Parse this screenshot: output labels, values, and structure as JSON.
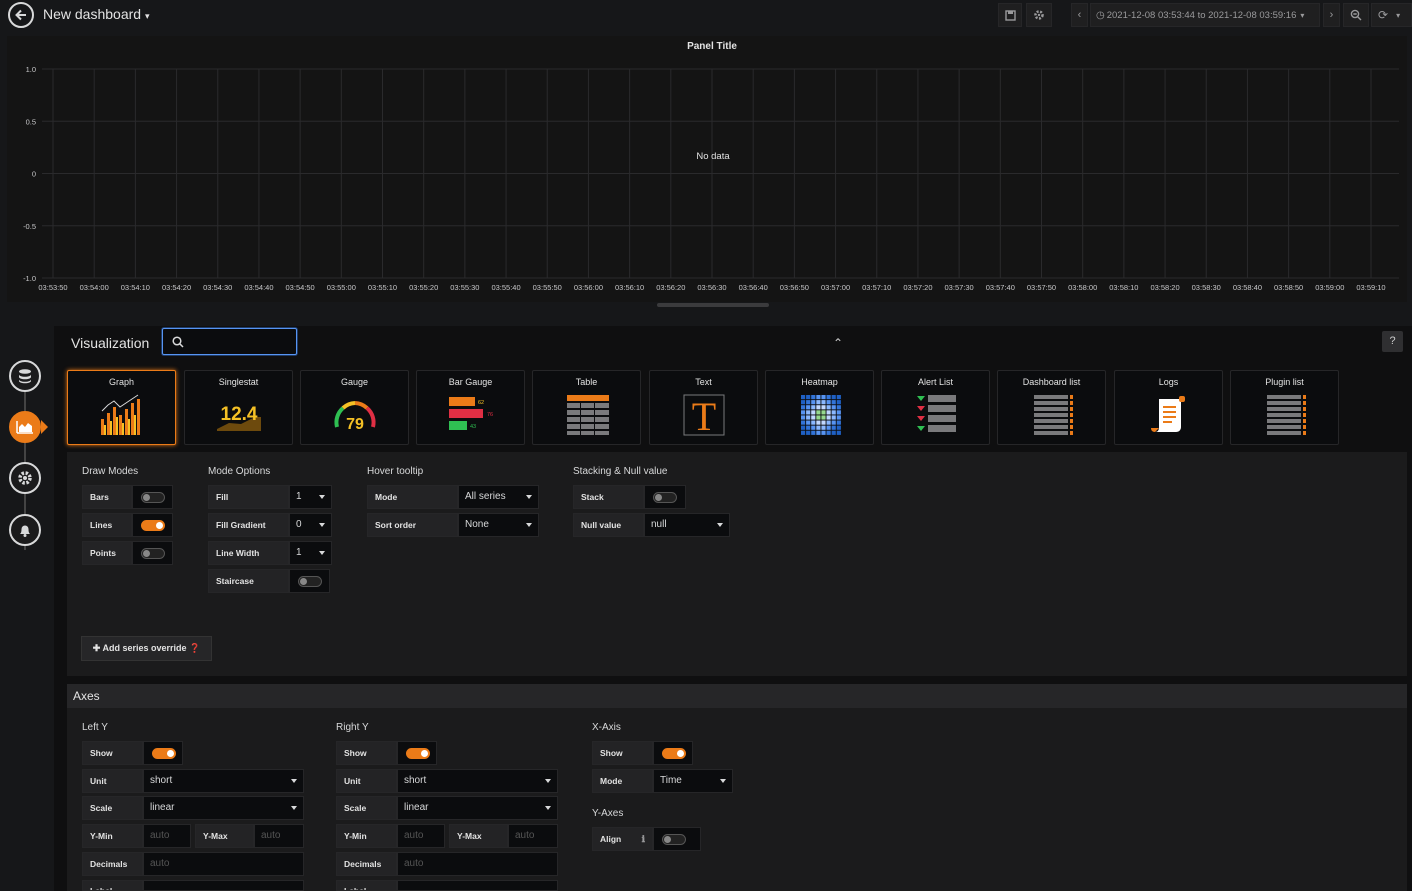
{
  "header": {
    "title": "New dashboard",
    "time_range": "2021-12-08 03:53:44 to 2021-12-08 03:59:16"
  },
  "panel": {
    "title": "Panel Title",
    "no_data": "No data",
    "y_ticks": [
      "1.0",
      "0.5",
      "0",
      "-0.5",
      "-1.0"
    ],
    "x_ticks": [
      "03:53:50",
      "03:54:00",
      "03:54:10",
      "03:54:20",
      "03:54:30",
      "03:54:40",
      "03:54:50",
      "03:55:00",
      "03:55:10",
      "03:55:20",
      "03:55:30",
      "03:55:40",
      "03:55:50",
      "03:56:00",
      "03:56:10",
      "03:56:20",
      "03:56:30",
      "03:56:40",
      "03:56:50",
      "03:57:00",
      "03:57:10",
      "03:57:20",
      "03:57:30",
      "03:57:40",
      "03:57:50",
      "03:58:00",
      "03:58:10",
      "03:58:20",
      "03:58:30",
      "03:58:40",
      "03:58:50",
      "03:59:00",
      "03:59:10"
    ]
  },
  "visualization": {
    "label": "Visualization",
    "help": "?",
    "types": [
      {
        "label": "Graph",
        "icon": "graph-icon"
      },
      {
        "label": "Singlestat",
        "icon": "singlestat-icon",
        "value": "12.4"
      },
      {
        "label": "Gauge",
        "icon": "gauge-icon",
        "value": "79"
      },
      {
        "label": "Bar Gauge",
        "icon": "bar-gauge-icon"
      },
      {
        "label": "Table",
        "icon": "table-icon"
      },
      {
        "label": "Text",
        "icon": "text-icon",
        "glyph": "T"
      },
      {
        "label": "Heatmap",
        "icon": "heatmap-icon"
      },
      {
        "label": "Alert List",
        "icon": "alert-list-icon"
      },
      {
        "label": "Dashboard list",
        "icon": "dashboard-list-icon"
      },
      {
        "label": "Logs",
        "icon": "logs-icon"
      },
      {
        "label": "Plugin list",
        "icon": "plugin-list-icon"
      }
    ],
    "bar_gauge_values": [
      "62",
      "76",
      "43"
    ]
  },
  "draw_modes": {
    "heading": "Draw Modes",
    "bars": {
      "label": "Bars",
      "on": false
    },
    "lines": {
      "label": "Lines",
      "on": true
    },
    "points": {
      "label": "Points",
      "on": false
    }
  },
  "mode_options": {
    "heading": "Mode Options",
    "fill": {
      "label": "Fill",
      "value": "1"
    },
    "fill_gradient": {
      "label": "Fill Gradient",
      "value": "0"
    },
    "line_width": {
      "label": "Line Width",
      "value": "1"
    },
    "staircase": {
      "label": "Staircase",
      "on": false
    }
  },
  "hover_tooltip": {
    "heading": "Hover tooltip",
    "mode": {
      "label": "Mode",
      "value": "All series"
    },
    "sort_order": {
      "label": "Sort order",
      "value": "None"
    }
  },
  "stacking": {
    "heading": "Stacking & Null value",
    "stack": {
      "label": "Stack",
      "on": false
    },
    "null_value": {
      "label": "Null value",
      "value": "null"
    }
  },
  "add_override": "Add series override",
  "axes": {
    "title": "Axes",
    "left_y": {
      "heading": "Left Y",
      "show": "Show",
      "unit_label": "Unit",
      "unit": "short",
      "scale_label": "Scale",
      "scale": "linear",
      "ymin_label": "Y-Min",
      "ymin_ph": "auto",
      "ymax_label": "Y-Max",
      "ymax_ph": "auto",
      "decimals_label": "Decimals",
      "decimals_ph": "auto",
      "label_label": "Label"
    },
    "right_y": {
      "heading": "Right Y",
      "show": "Show",
      "unit_label": "Unit",
      "unit": "short",
      "scale_label": "Scale",
      "scale": "linear",
      "ymin_label": "Y-Min",
      "ymin_ph": "auto",
      "ymax_label": "Y-Max",
      "ymax_ph": "auto",
      "decimals_label": "Decimals",
      "decimals_ph": "auto",
      "label_label": "Label"
    },
    "x_axis": {
      "heading": "X-Axis",
      "show": "Show",
      "mode_label": "Mode",
      "mode": "Time"
    },
    "y_axes": {
      "heading": "Y-Axes",
      "align_label": "Align"
    }
  },
  "colors": {
    "accent": "#eb7b18",
    "focus": "#5794f2",
    "bg": "#161719"
  }
}
